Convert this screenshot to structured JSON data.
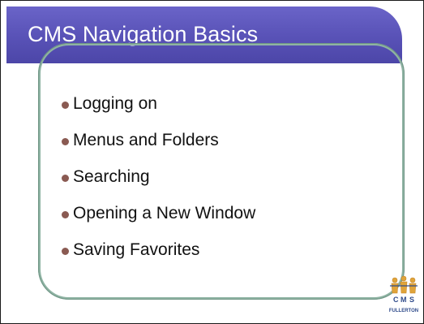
{
  "slide": {
    "title": "CMS Navigation Basics",
    "bullets": [
      "Logging on",
      "Menus and Folders",
      "Searching",
      "Opening a New Window",
      "Saving Favorites"
    ]
  },
  "logo": {
    "letters": "C M S",
    "caption": "FULLERTON",
    "icon": "cms-fullerton-logo-icon"
  },
  "colors": {
    "title_bar": "#5a53b8",
    "frame": "#8fb3a3",
    "bullet_dot": "#8a5a52"
  }
}
